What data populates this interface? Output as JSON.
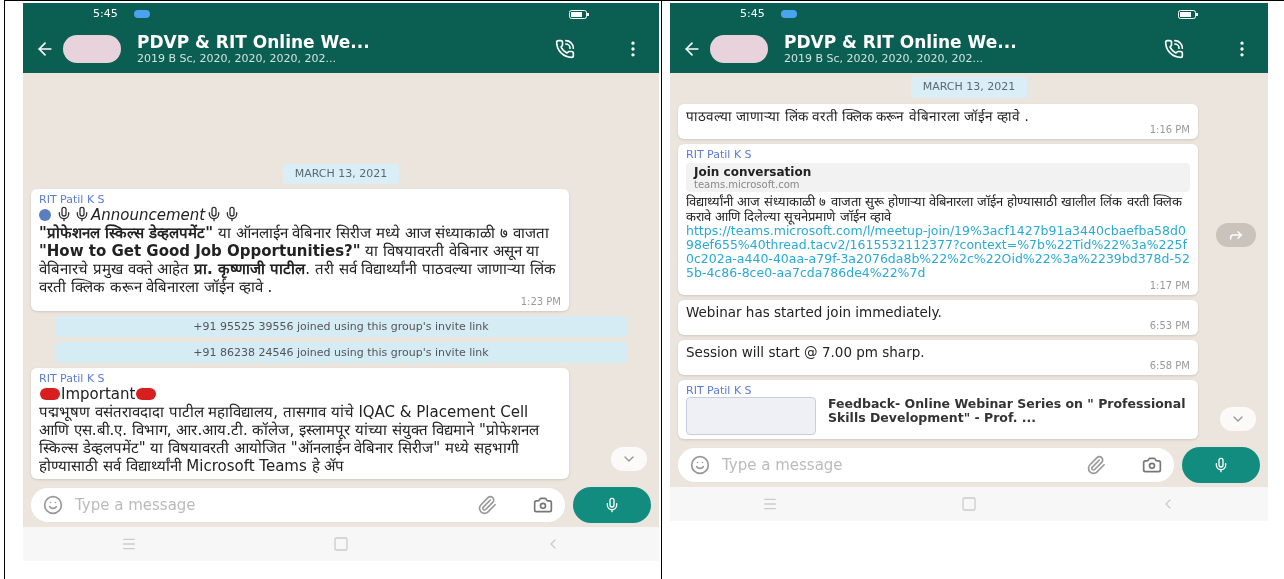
{
  "phones": [
    {
      "status_bar": {
        "time": "5:45"
      },
      "header": {
        "title": "PDVP & RIT Online We...",
        "subtitle": "2019 B Sc, 2020, 2020, 2020, 202..."
      },
      "messages": [
        {
          "kind": "date",
          "text": "MARCH 13, 2021"
        },
        {
          "kind": "incoming",
          "sender": "RIT Patil K S",
          "body": [
            {
              "kind": "blue-dot"
            },
            {
              "kind": "mic"
            },
            {
              "kind": "mic"
            },
            {
              "kind": "text",
              "text": "*Announcement*"
            },
            {
              "kind": "mic"
            },
            {
              "kind": "mic"
            },
            {
              "kind": "break"
            },
            {
              "kind": "text",
              "text": "**\"प्रोफेशनल स्किल्स डेव्हलपमेंट\"** या ऑनलाईन वेबिनार सिरीज मध्ये आज संध्याकाळी ७ वाजता **\"How to Get Good Job Opportunities?\"** या विषयावरती वेबिनार असून या वेबिनारचे प्रमुख वक्ते आहेत **प्रा. कृष्णाजी पाटील**. तरी सर्व विद्यार्थ्यांनी पाठवल्या जाणाऱ्या लिंक वरती क्लिक करून वेबिनारला जॉईन व्हावे ."
            }
          ],
          "time": "1:23 PM"
        },
        {
          "kind": "system",
          "text": "+91 95525 39556 joined using this group's invite link"
        },
        {
          "kind": "system",
          "text": "+91 86238 24546 joined using this group's invite link"
        },
        {
          "kind": "incoming",
          "sender": "RIT Patil K S",
          "body": [
            {
              "kind": "red-dot"
            },
            {
              "kind": "text",
              "text": "Important"
            },
            {
              "kind": "red-dot"
            },
            {
              "kind": "break"
            },
            {
              "kind": "text",
              "text": "पद्मभूषण वसंतरावदादा पाटील महाविद्यालय, तासगाव यांचे IQAC & Placement Cell आणि एस.बी.ए. विभाग, आर.आय.टी. कॉलेज, इस्लामपूर यांच्या संयुक्त विद्यमाने \"प्रोफेशनल स्किल्स डेव्हलपमेंट\" या विषयावरती आयोजित \"ऑनलाईन वेबिनार सिरीज\" मध्ये सहभागी होण्यासाठी सर्व विद्यार्थ्यांनी Microsoft Teams हे ॲप"
            }
          ]
        }
      ],
      "input": {
        "placeholder": "Type a message"
      }
    },
    {
      "status_bar": {
        "time": "5:45"
      },
      "header": {
        "title": "PDVP & RIT Online We...",
        "subtitle": "2019 B Sc, 2020, 2020, 2020, 202..."
      },
      "floating_date": "MARCH 13, 2021",
      "messages": [
        {
          "kind": "incoming",
          "body": [
            {
              "kind": "text",
              "text": "पाठवल्या जाणाऱ्या लिंक वरती क्लिक करून वेबिनारला जॉईन व्हावे ."
            }
          ],
          "time": "1:16 PM"
        },
        {
          "kind": "link",
          "sender": "RIT Patil K S",
          "preview_title": "Join conversation",
          "preview_domain": "teams.microsoft.com",
          "text": "विद्यार्थ्यांनी आज संध्याकाळी ७ वाजता सुरू होणाऱ्या वेबिनारला जॉईन होण्यासाठी खालील लिंक वरती क्लिक करावे आणि दिलेल्या सूचनेप्रमाणे जॉईन व्हावे",
          "url": "https://teams.microsoft.com/l/meetup-join/19%3acf1427b91a3440cbaefba58d098ef655%40thread.tacv2/1615532112377?context=%7b%22Tid%22%3a%225f0c202a-a440-40aa-a79f-3a2076da8b%22%2c%22Oid%22%3a%2239bd378d-525b-4c86-8ce0-aa7cda786de4%22%7d",
          "time": "1:17 PM"
        },
        {
          "kind": "incoming",
          "body": [
            {
              "kind": "text",
              "text": "Webinar has started join immediately."
            }
          ],
          "time": "6:53 PM"
        },
        {
          "kind": "incoming",
          "body": [
            {
              "kind": "text",
              "text": "Session will start @ 7.00 pm sharp."
            }
          ],
          "time": "6:58 PM"
        },
        {
          "kind": "file",
          "sender": "RIT Patil K S",
          "text": "Feedback- Online Webinar Series on \" Professional Skills Development\" - Prof. ..."
        }
      ],
      "input": {
        "placeholder": "Type a message"
      }
    }
  ]
}
